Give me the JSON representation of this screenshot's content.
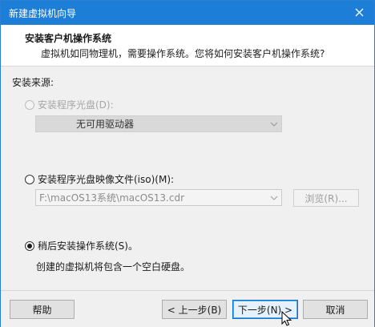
{
  "window": {
    "title": "新建虚拟机向导"
  },
  "header": {
    "title": "安装客户机操作系统",
    "subtitle": "虚拟机如同物理机，需要操作系统。您将如何安装客户机操作系统?"
  },
  "source": {
    "label": "安装来源:",
    "disc": {
      "label": "安装程序光盘(D):",
      "drive_value": "无可用驱动器",
      "enabled": false,
      "selected": false
    },
    "iso": {
      "label": "安装程序光盘映像文件(iso)(M):",
      "path": "F:\\macOS13系统\\macOS13.cdr",
      "browse_label": "浏览(R)...",
      "selected": false
    },
    "later": {
      "label": "稍后安装操作系统(S)。",
      "description": "创建的虚拟机将包含一个空白硬盘。",
      "selected": true
    }
  },
  "footer": {
    "help_label": "帮助",
    "back_label": "< 上一步(B)",
    "next_label": "下一步(N) >",
    "cancel_label": "取消"
  },
  "colors": {
    "titlebar": "#1c7ed6",
    "accent": "#0078d7",
    "disabled_text": "#a6a6a6"
  },
  "icons": {
    "close": "close-icon",
    "dropdown": "chevron-down-icon",
    "cursor": "mouse-pointer-icon"
  }
}
